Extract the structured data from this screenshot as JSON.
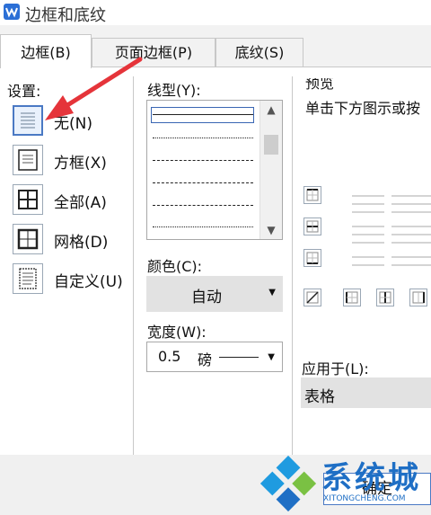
{
  "window": {
    "title": "边框和底纹"
  },
  "tabs": [
    {
      "label": "边框(B)",
      "active": true
    },
    {
      "label": "页面边框(P)",
      "active": false
    },
    {
      "label": "底纹(S)",
      "active": false
    }
  ],
  "settings": {
    "label": "设置:",
    "items": [
      {
        "label": "无(N)",
        "icon": "none-border-icon",
        "selected": true
      },
      {
        "label": "方框(X)",
        "icon": "box-border-icon",
        "selected": false
      },
      {
        "label": "全部(A)",
        "icon": "all-borders-icon",
        "selected": false
      },
      {
        "label": "网格(D)",
        "icon": "grid-border-icon",
        "selected": false
      },
      {
        "label": "自定义(U)",
        "icon": "custom-border-icon",
        "selected": false
      }
    ]
  },
  "line_style": {
    "label": "线型(Y):"
  },
  "color": {
    "label": "颜色(C):",
    "value": "自动"
  },
  "width": {
    "label": "宽度(W):",
    "value": "0.5",
    "unit": "磅"
  },
  "preview": {
    "label": "预览",
    "hint": "单击下方图示或按"
  },
  "apply_to": {
    "label": "应用于(L):",
    "value": "表格"
  },
  "footer": {
    "ok_label": "确定"
  },
  "watermark": {
    "text": "系统城",
    "sub": "XITONGCHENG.COM"
  },
  "colors": {
    "accent": "#4a79c4",
    "annotation_arrow": "#e5343a",
    "watermark": "#1f6fc5"
  }
}
